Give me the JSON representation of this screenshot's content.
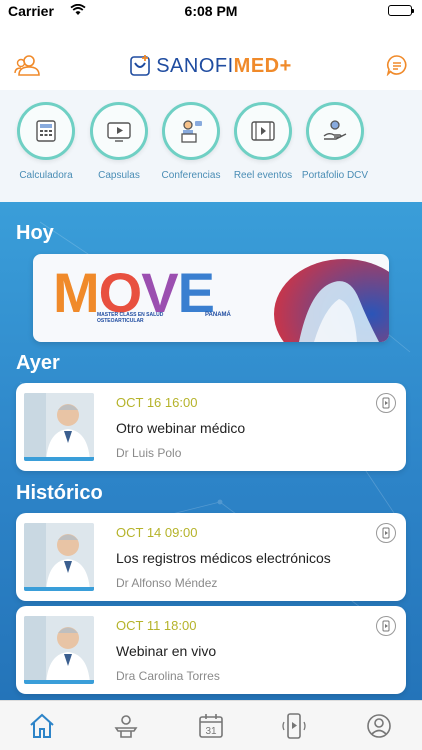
{
  "status": {
    "carrier": "Carrier",
    "time": "6:08 PM"
  },
  "header": {
    "brand_sanofi": "SANOFI",
    "brand_med": "MED+"
  },
  "quick_actions": [
    {
      "label": "Calculadora",
      "icon": "calculator-icon"
    },
    {
      "label": "Capsulas",
      "icon": "tv-play-icon"
    },
    {
      "label": "Conferencias",
      "icon": "conference-icon"
    },
    {
      "label": "Reel eventos",
      "icon": "film-reel-icon"
    },
    {
      "label": "Portafolio DCV",
      "icon": "hand-portfolio-icon"
    }
  ],
  "sections": {
    "today": "Hoy",
    "yesterday": "Ayer",
    "history": "Histórico"
  },
  "banner": {
    "word": "MOVE",
    "sub": "MASTER CLASS EN SALUD OSTEOARTICULAR",
    "city": "PANAMÁ"
  },
  "cards": [
    {
      "date": "OCT 16 16:00",
      "title": "Otro webinar médico",
      "author": "Dr Luis Polo"
    },
    {
      "date": "OCT 14 09:00",
      "title": "Los registros médicos electrónicos",
      "author": "Dr Alfonso Méndez"
    },
    {
      "date": "OCT 11 18:00",
      "title": "Webinar en vivo",
      "author": "Dra Carolina Torres"
    }
  ],
  "colors": {
    "accent": "#f08a2a",
    "brand_blue": "#1f4ca0",
    "teal": "#6fd0c4",
    "date": "#b5b32a",
    "bg_gradient_top": "#3a9ed9",
    "bg_gradient_bottom": "#2474b9"
  }
}
